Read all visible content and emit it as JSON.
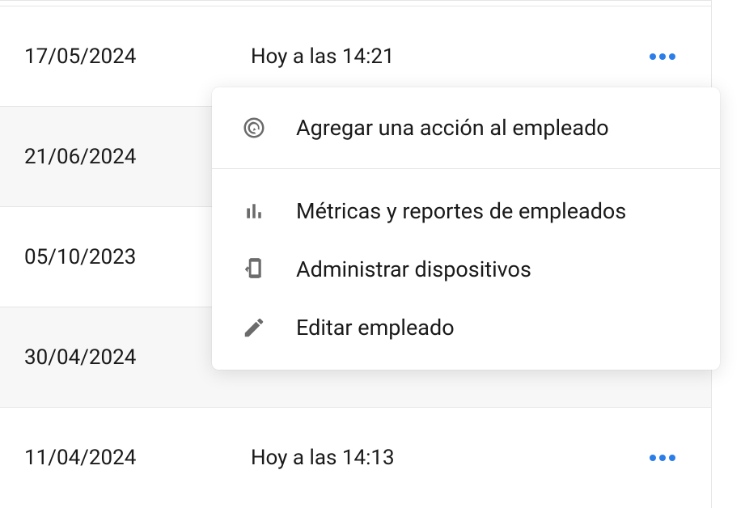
{
  "rows": [
    {
      "date": "17/05/2024",
      "time": "Hoy a las 14:21",
      "hasMenu": true
    },
    {
      "date": "21/06/2024",
      "time": "",
      "hasMenu": false
    },
    {
      "date": "05/10/2023",
      "time": "",
      "hasMenu": false
    },
    {
      "date": "30/04/2024",
      "time": "",
      "hasMenu": false
    },
    {
      "date": "11/04/2024",
      "time": "Hoy a las 14:13",
      "hasMenu": true
    }
  ],
  "menu": {
    "items": [
      {
        "label": "Agregar una acción al empleado",
        "icon": "target"
      },
      {
        "label": "Métricas y reportes de empleados",
        "icon": "chart"
      },
      {
        "label": "Administrar dispositivos",
        "icon": "device"
      },
      {
        "label": "Editar empleado",
        "icon": "pencil"
      }
    ]
  }
}
